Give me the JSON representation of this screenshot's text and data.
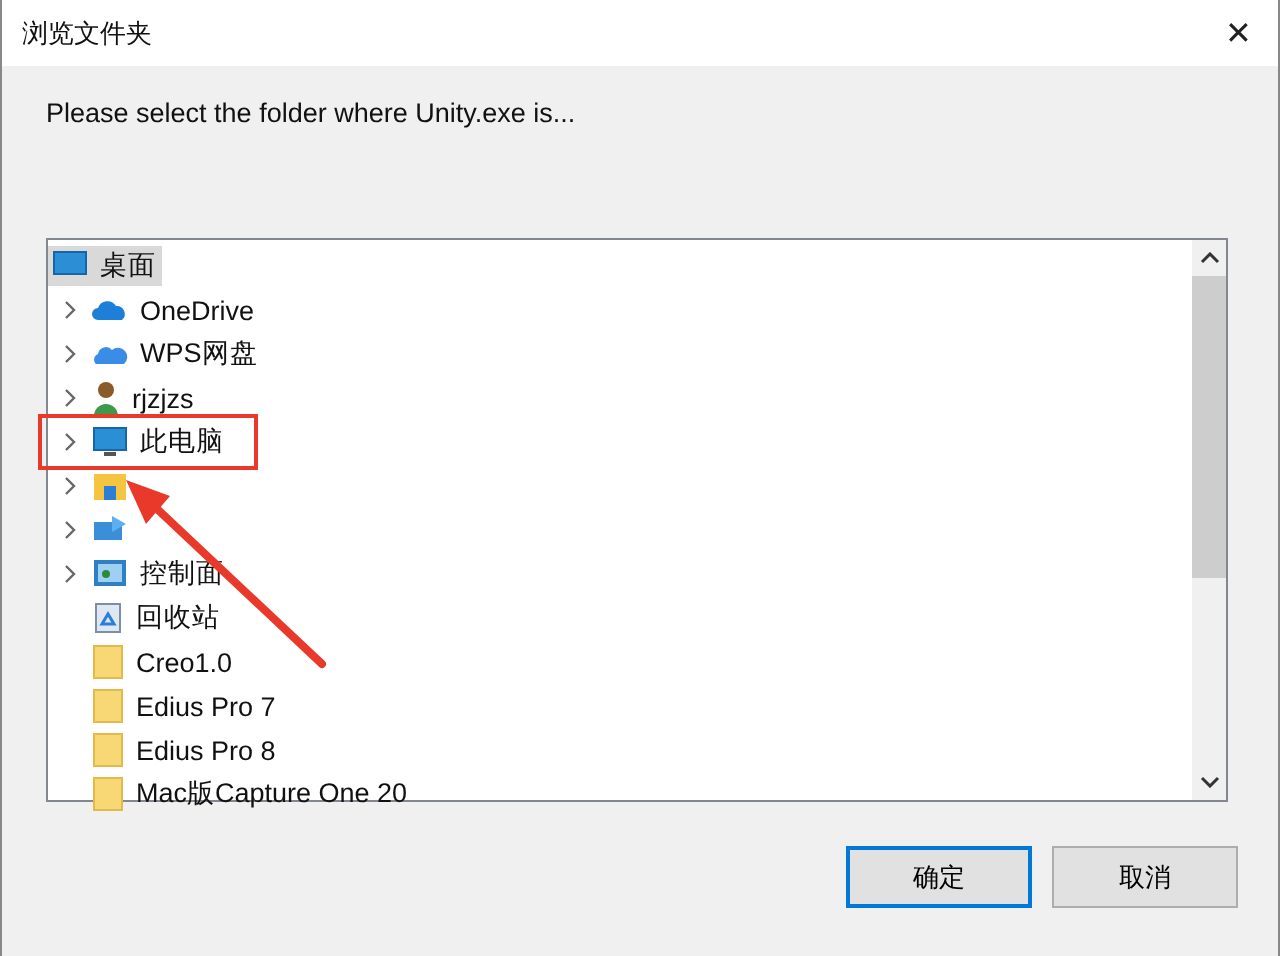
{
  "window": {
    "title": "浏览文件夹",
    "close": "✕"
  },
  "prompt": "Please select the folder where Unity.exe is...",
  "tree": {
    "root": {
      "label": "桌面",
      "kind": "desktop",
      "selected": true
    },
    "items": [
      {
        "label": "OneDrive",
        "kind": "cloud",
        "expandable": true,
        "selected": false,
        "annotated": false
      },
      {
        "label": "WPS网盘",
        "kind": "wps",
        "expandable": true,
        "selected": false,
        "annotated": false
      },
      {
        "label": "rjzjzs",
        "kind": "user",
        "expandable": true,
        "selected": false,
        "annotated": false
      },
      {
        "label": "此电脑",
        "kind": "pc",
        "expandable": true,
        "selected": false,
        "annotated": true
      },
      {
        "kind": "library",
        "expandable": true,
        "selected": false,
        "annotated": false
      },
      {
        "kind": "network",
        "expandable": true,
        "selected": false,
        "annotated": false
      },
      {
        "label": "控制面",
        "kind": "control",
        "expandable": true,
        "selected": false,
        "annotated": false
      },
      {
        "label": "回收站",
        "kind": "recycle",
        "expandable": false,
        "selected": false,
        "annotated": false
      },
      {
        "label": "Creo1.0",
        "kind": "folder",
        "expandable": false,
        "selected": false,
        "annotated": false
      },
      {
        "label": "Edius Pro 7",
        "kind": "folder",
        "expandable": false,
        "selected": false,
        "annotated": false
      },
      {
        "label": "Edius Pro 8",
        "kind": "folder",
        "expandable": false,
        "selected": false,
        "annotated": false
      },
      {
        "label": "Mac版Capture One 20",
        "kind": "folder",
        "expandable": false,
        "selected": false,
        "annotated": false
      }
    ]
  },
  "buttons": [
    {
      "label": "确定",
      "default": true
    },
    {
      "label": "取消",
      "default": false
    }
  ]
}
